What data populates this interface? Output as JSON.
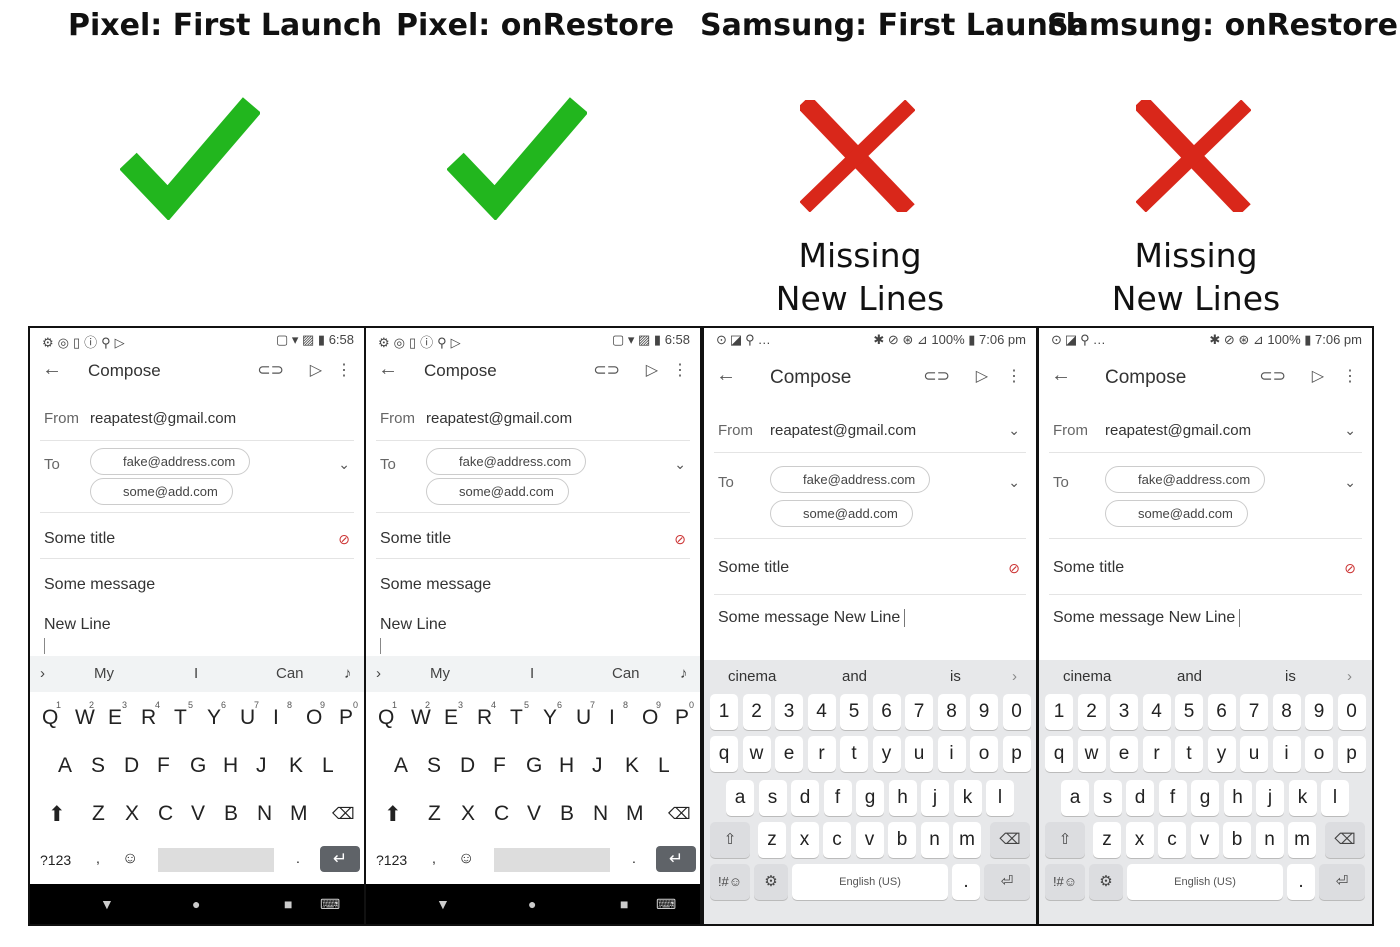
{
  "headers": [
    "Pixel: First Launch",
    "Pixel: onRestore",
    "Samsung: First Launch",
    "Samsung: onRestore"
  ],
  "results": [
    {
      "ok": true,
      "icon": "check-icon"
    },
    {
      "ok": true,
      "icon": "check-icon"
    },
    {
      "ok": false,
      "icon": "cross-icon",
      "line1": "Missing",
      "line2": "New Lines"
    },
    {
      "ok": false,
      "icon": "cross-icon",
      "line1": "Missing",
      "line2": "New Lines"
    }
  ],
  "colors": {
    "check": "#22b61e",
    "cross": "#d9271a",
    "gboard_enter": "#5f6368",
    "samsung_kb": "#e7e8ea"
  },
  "pixel": {
    "status_time": "6:58",
    "compose": "Compose",
    "from_label": "From",
    "from": "reapatest@gmail.com",
    "to_label": "To",
    "to1": "fake@address.com",
    "to2": "some@add.com",
    "subject": "Some title",
    "message": "Some message",
    "newline": "New Line",
    "suggestions": [
      "My",
      "I",
      "Can"
    ],
    "row1": [
      "Q",
      "W",
      "E",
      "R",
      "T",
      "Y",
      "U",
      "I",
      "O",
      "P"
    ],
    "row1_nums": [
      "1",
      "2",
      "3",
      "4",
      "5",
      "6",
      "7",
      "8",
      "9",
      "0"
    ],
    "row2": [
      "A",
      "S",
      "D",
      "F",
      "G",
      "H",
      "J",
      "K",
      "L"
    ],
    "row3": [
      "Z",
      "X",
      "C",
      "V",
      "B",
      "N",
      "M"
    ],
    "sym": "?123",
    "comma": ",",
    "period": "."
  },
  "samsung": {
    "status_time": "100% ▮ 7:06 pm",
    "compose": "Compose",
    "from_label": "From",
    "from": "reapatest@gmail.com",
    "to_label": "To",
    "to1": "fake@address.com",
    "to2": "some@add.com",
    "subject": "Some title",
    "message": "Some message New Line",
    "suggestions": [
      "cinema",
      "and",
      "is"
    ],
    "nums": [
      "1",
      "2",
      "3",
      "4",
      "5",
      "6",
      "7",
      "8",
      "9",
      "0"
    ],
    "row1": [
      "q",
      "w",
      "e",
      "r",
      "t",
      "y",
      "u",
      "i",
      "o",
      "p"
    ],
    "row2": [
      "a",
      "s",
      "d",
      "f",
      "g",
      "h",
      "j",
      "k",
      "l"
    ],
    "row3": [
      "z",
      "x",
      "c",
      "v",
      "b",
      "n",
      "m"
    ],
    "sym": "!#☺",
    "space": "English (US)",
    "period": "."
  }
}
